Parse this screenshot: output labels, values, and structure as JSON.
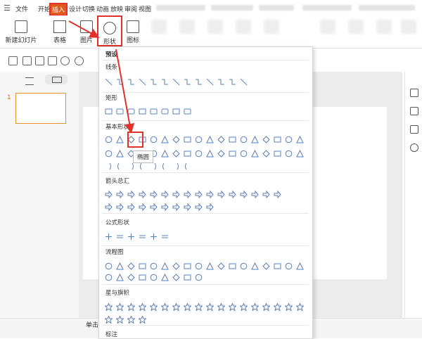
{
  "menubar": {
    "file": "文件",
    "tabs": [
      "开始",
      "插入",
      "设计",
      "切换",
      "动画",
      "放映",
      "审阅",
      "视图"
    ],
    "active_tab": "插入"
  },
  "ribbon": {
    "new_slide": "新建幻灯片",
    "table": "表格",
    "picture": "图片",
    "shape": "形状",
    "icon": "图标"
  },
  "left_panel": {
    "slide_number": "1",
    "add": "+"
  },
  "status": {
    "text": "单击"
  },
  "dropdown": {
    "title": "预设",
    "categories": {
      "lines": "线条",
      "rectangles": "矩形",
      "basic": "基本形状",
      "arrows": "箭头总汇",
      "equation": "公式形状",
      "flowchart": "流程图",
      "stars": "星与旗帜",
      "callouts": "标注"
    },
    "tooltip": "椭圆"
  },
  "colors": {
    "accent": "#e0322a",
    "active_tab_bg": "#e05a1e",
    "shape_stroke": "#5a7fb8",
    "thumb_border": "#e8902e"
  }
}
